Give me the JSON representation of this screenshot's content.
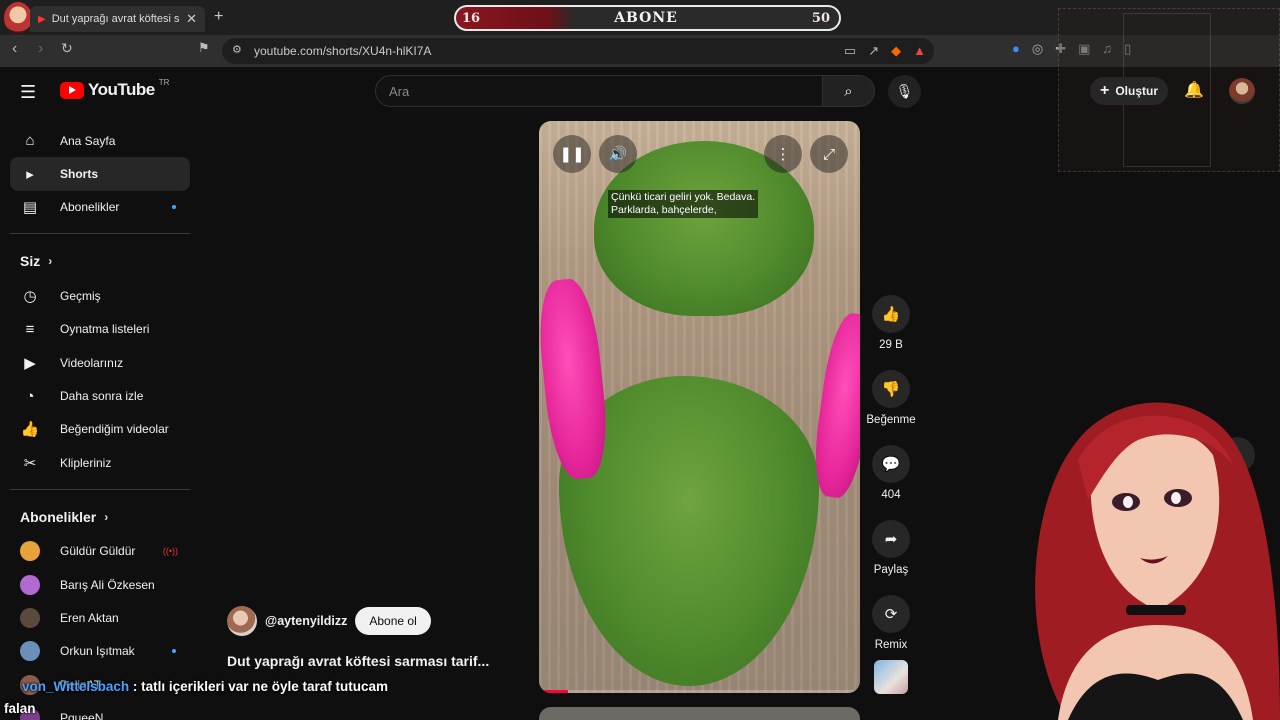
{
  "browser": {
    "tab_title": "Dut yaprağı avrat köftesi sarma",
    "url": "youtube.com/shorts/XU4n-hlKI7A"
  },
  "stream_overlay": {
    "sub_label": "ABONE",
    "sub_current": "16",
    "sub_goal": "50",
    "sub_progress": 0.32
  },
  "header": {
    "logo_text": "YouTube",
    "country": "TR",
    "search_placeholder": "Ara",
    "create_label": "Oluştur"
  },
  "sidebar": {
    "main": [
      {
        "label": "Ana Sayfa",
        "icon": "home-icon"
      },
      {
        "label": "Shorts",
        "icon": "shorts-icon",
        "active": true
      },
      {
        "label": "Abonelikler",
        "icon": "subscriptions-icon",
        "dot": true
      }
    ],
    "you_title": "Siz",
    "you": [
      {
        "label": "Geçmiş",
        "icon": "history-icon"
      },
      {
        "label": "Oynatma listeleri",
        "icon": "playlists-icon"
      },
      {
        "label": "Videolarınız",
        "icon": "your-videos-icon"
      },
      {
        "label": "Daha sonra izle",
        "icon": "watch-later-icon"
      },
      {
        "label": "Beğendiğim videolar",
        "icon": "liked-icon"
      },
      {
        "label": "Klipleriniz",
        "icon": "clips-icon"
      }
    ],
    "subs_title": "Abonelikler",
    "subs": [
      {
        "label": "Güldür Güldür",
        "color": "#e9a13b",
        "live": true
      },
      {
        "label": "Barış Ali Özkesen",
        "color": "#b06ad0"
      },
      {
        "label": "Eren Aktan",
        "color": "#5a4a3e"
      },
      {
        "label": "Orkun Işıtmak",
        "color": "#6a8fb8",
        "dot": true
      },
      {
        "label": "PelinAT",
        "color": "#8d5b4c"
      },
      {
        "label": "PqueeN",
        "color": "#7a3f8f"
      }
    ]
  },
  "video": {
    "caption_line1": "Çünkü ticari geliri yok. Bedava.",
    "caption_line2": "Parklarda, bahçelerde,",
    "progress": 0.09,
    "channel": "@aytenyildizz",
    "subscribe_label": "Abone ol",
    "title": "Dut yaprağı avrat köftesi sarması tarif..."
  },
  "actions": {
    "like_count": "29 B",
    "dislike_label": "Beğenme",
    "comment_count": "404",
    "share_label": "Paylaş",
    "remix_label": "Remix"
  },
  "chat": {
    "username": "von_Wittelsbach",
    "message": ": tatlı içerikleri var ne öyle taraf tutucam falan"
  }
}
